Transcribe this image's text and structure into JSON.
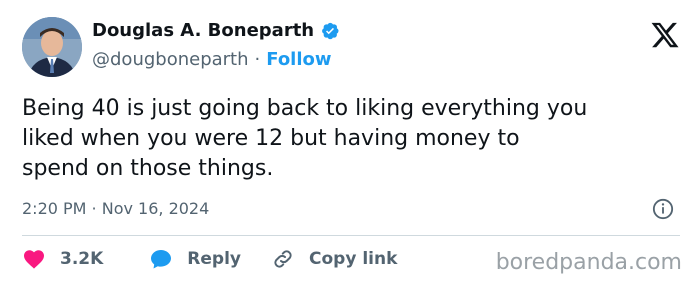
{
  "author": {
    "name": "Douglas A. Boneparth",
    "handle": "@dougboneparth",
    "separator": "·",
    "follow_label": "Follow",
    "verified": true
  },
  "tweet": {
    "text": "Being 40 is just going back to liking everything you\nliked when you were 12 but having money to\nspend on those things.",
    "timestamp": "2:20 PM · Nov 16, 2024"
  },
  "actions": {
    "likes": "3.2K",
    "reply_label": "Reply",
    "copy_label": "Copy link"
  },
  "watermark": "boredpanda.com",
  "icons": {
    "logo": "x-logo-icon",
    "verified": "verified-badge-icon",
    "info": "info-icon",
    "like": "heart-icon",
    "reply": "speech-bubble-icon",
    "copy": "link-icon"
  },
  "colors": {
    "accent": "#1d9bf0",
    "like": "#f91880",
    "text": "#0f1419",
    "muted": "#536471"
  }
}
